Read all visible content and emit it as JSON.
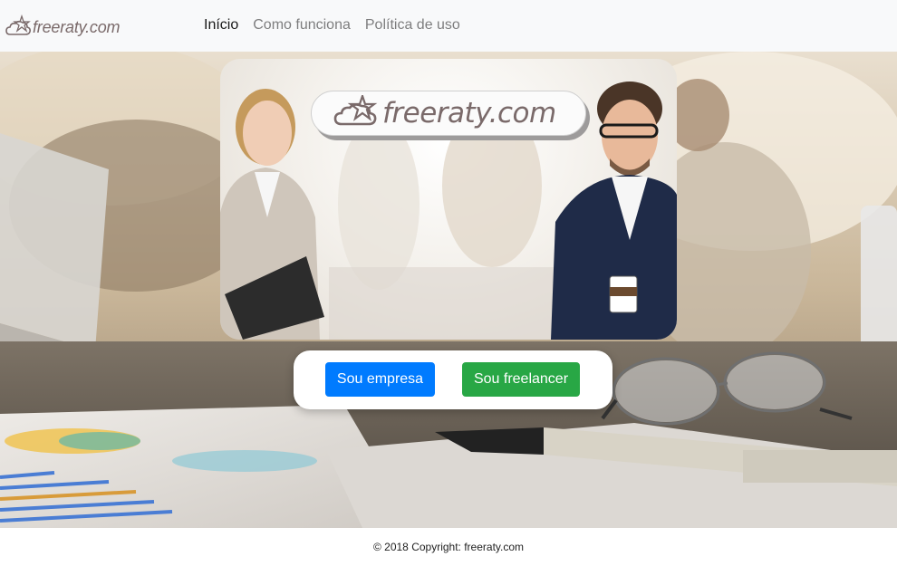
{
  "brand": {
    "name": "freeraty.com",
    "logo_icon": "cloud-star-icon"
  },
  "nav": {
    "items": [
      {
        "label": "Início",
        "active": true
      },
      {
        "label": "Como funciona",
        "active": false
      },
      {
        "label": "Política de uso",
        "active": false
      }
    ]
  },
  "hero": {
    "logo_text": "freeraty.com",
    "buttons": {
      "empresa": "Sou empresa",
      "freelancer": "Sou freelancer"
    }
  },
  "footer": {
    "copyright": "© 2018 Copyright: freeraty.com"
  },
  "colors": {
    "navbar_bg": "#f8f9fa",
    "brand_text": "#7a6a6a",
    "primary_button": "#007bff",
    "success_button": "#28a745"
  }
}
